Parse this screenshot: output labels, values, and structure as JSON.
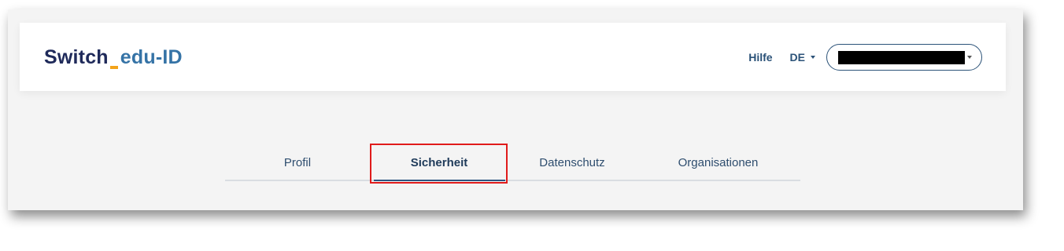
{
  "header": {
    "logo": {
      "part1": "Switch",
      "part2": "edu-ID"
    },
    "help_label": "Hilfe",
    "language": {
      "selected": "DE"
    },
    "user_menu": {
      "name": "[redacted]"
    }
  },
  "tabs": [
    {
      "label": "Profil",
      "active": false
    },
    {
      "label": "Sicherheit",
      "active": true
    },
    {
      "label": "Datenschutz",
      "active": false
    },
    {
      "label": "Organisationen",
      "active": false
    }
  ],
  "colors": {
    "brand_dark": "#1f2a5a",
    "brand_blue": "#3573a6",
    "brand_accent": "#f3a31a",
    "link": "#2b5278",
    "highlight": "#e01b1b"
  },
  "icons": {
    "language_dropdown": "chevron-down-icon",
    "user_dropdown": "chevron-down-icon"
  }
}
